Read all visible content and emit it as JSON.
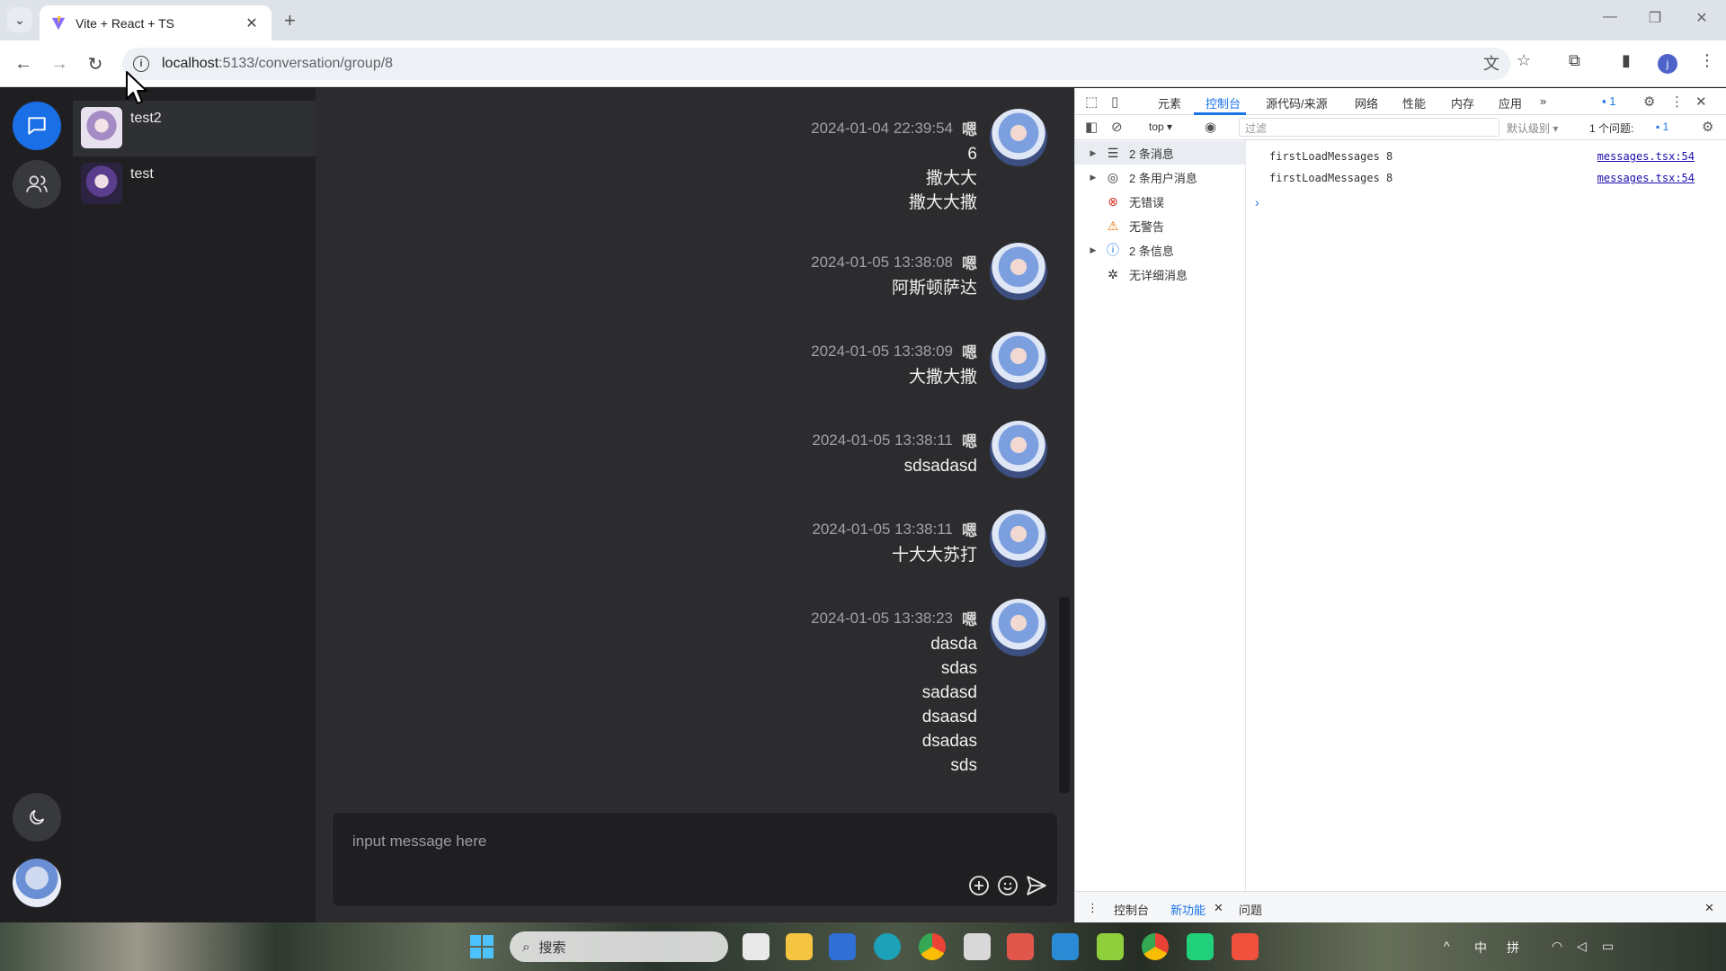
{
  "browser": {
    "tab_title": "Vite + React + TS",
    "url_host": "localhost",
    "url_path": ":5133/conversation/group/8",
    "profile_initial": "j"
  },
  "app": {
    "conversations": [
      {
        "name": "test2",
        "active": true
      },
      {
        "name": "test",
        "active": false
      }
    ],
    "messages": [
      {
        "time": "2024-01-04 22:39:54",
        "user": "嗯",
        "lines": [
          "6",
          "撒大大",
          "撒大大撒"
        ]
      },
      {
        "time": "2024-01-05 13:38:08",
        "user": "嗯",
        "lines": [
          "阿斯顿萨达"
        ]
      },
      {
        "time": "2024-01-05 13:38:09",
        "user": "嗯",
        "lines": [
          "大撒大撒"
        ]
      },
      {
        "time": "2024-01-05 13:38:11",
        "user": "嗯",
        "lines": [
          "sdsadasd"
        ]
      },
      {
        "time": "2024-01-05 13:38:11",
        "user": "嗯",
        "lines": [
          "十大大苏打"
        ]
      },
      {
        "time": "2024-01-05 13:38:23",
        "user": "嗯",
        "lines": [
          "dasda",
          "sdas",
          "sadasd",
          "dsaasd",
          "dsadas",
          "sds"
        ]
      }
    ],
    "composer_placeholder": "input message here"
  },
  "devtools": {
    "tabs": [
      "元素",
      "控制台",
      "源代码/来源",
      "网络",
      "性能",
      "内存",
      "应用"
    ],
    "active_tab": "控制台",
    "issue_badge": "1",
    "context": "top",
    "filter_placeholder": "过滤",
    "level": "默认级别",
    "issues_label": "1 个问题:",
    "issues_count": "1",
    "sidebar": [
      {
        "label": "2 条消息",
        "icon": "list-icon",
        "expandable": true
      },
      {
        "label": "2 条用户消息",
        "icon": "user-circle-icon",
        "expandable": true
      },
      {
        "label": "无错误",
        "icon": "error-icon",
        "expandable": false
      },
      {
        "label": "无警告",
        "icon": "warning-icon",
        "expandable": false
      },
      {
        "label": "2 条信息",
        "icon": "info-icon",
        "expandable": true
      },
      {
        "label": "无详细消息",
        "icon": "bug-icon",
        "expandable": false
      }
    ],
    "logs": [
      {
        "text": "firstLoadMessages 8",
        "source": "messages.tsx:54"
      },
      {
        "text": "firstLoadMessages 8",
        "source": "messages.tsx:54"
      }
    ],
    "drawer_tabs": [
      "控制台",
      "新功能",
      "问题"
    ],
    "drawer_active": "新功能"
  },
  "taskbar": {
    "search_label": "搜索",
    "ime_1": "中",
    "ime_2": "拼"
  },
  "colors": {
    "accent": "#1a6ee6",
    "devtools_accent": "#1a73e8",
    "chat_bg": "#2c2c2f"
  }
}
